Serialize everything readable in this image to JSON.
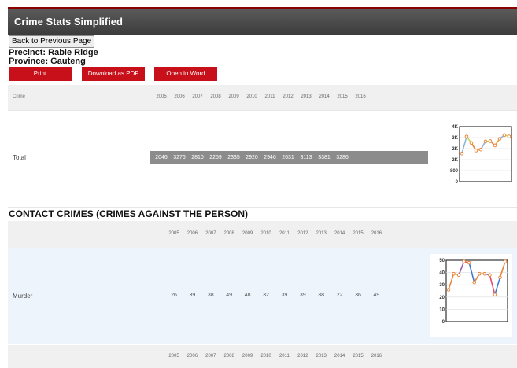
{
  "app": {
    "title": "Crime Stats Simplified"
  },
  "nav": {
    "back_label": "Back to Previous Page"
  },
  "info": {
    "precinct": "Precinct: Rabie Ridge",
    "province": "Province: Gauteng"
  },
  "actions": {
    "print": "Print",
    "download_pdf": "Download as PDF",
    "open_word": "Open in Word"
  },
  "years": [
    "2005",
    "2006",
    "2007",
    "2008",
    "2009",
    "2010",
    "2011",
    "2012",
    "2013",
    "2014",
    "2015",
    "2016"
  ],
  "table": {
    "crime_header": "Crime"
  },
  "total": {
    "label": "Total",
    "values": [
      "2046",
      "3276",
      "2810",
      "2259",
      "2335",
      "2920",
      "2946",
      "2631",
      "3113",
      "3381",
      "3286"
    ]
  },
  "section": {
    "title": "CONTACT CRIMES (CRIMES AGAINST THE PERSON)"
  },
  "murder": {
    "label": "Murder",
    "values": [
      "26",
      "39",
      "38",
      "49",
      "48",
      "32",
      "39",
      "39",
      "38",
      "22",
      "36",
      "49"
    ]
  },
  "colors": {
    "header_bg": "#444444",
    "button_red": "#c8101a",
    "total_bar": "#8c8c8c",
    "murder_row_bg": "#eef4fb"
  },
  "chart_data": [
    {
      "type": "line",
      "ylim": [
        0,
        4000
      ],
      "y_ticks": [
        "4K",
        "3K",
        "2K",
        "2K",
        "800",
        "0"
      ],
      "series": [
        {
          "values": [
            2046,
            3276,
            2810,
            2259,
            2335,
            2920,
            2946,
            2631,
            3113,
            3381,
            3286
          ]
        }
      ],
      "grid": true
    },
    {
      "type": "line",
      "ylim": [
        0,
        50
      ],
      "y_ticks": [
        "50",
        "40",
        "30",
        "20",
        "10",
        "0"
      ],
      "series": [
        {
          "values": [
            26,
            39,
            38,
            49,
            48,
            32,
            39,
            39,
            38,
            22,
            36,
            49
          ]
        }
      ],
      "grid": true
    }
  ]
}
